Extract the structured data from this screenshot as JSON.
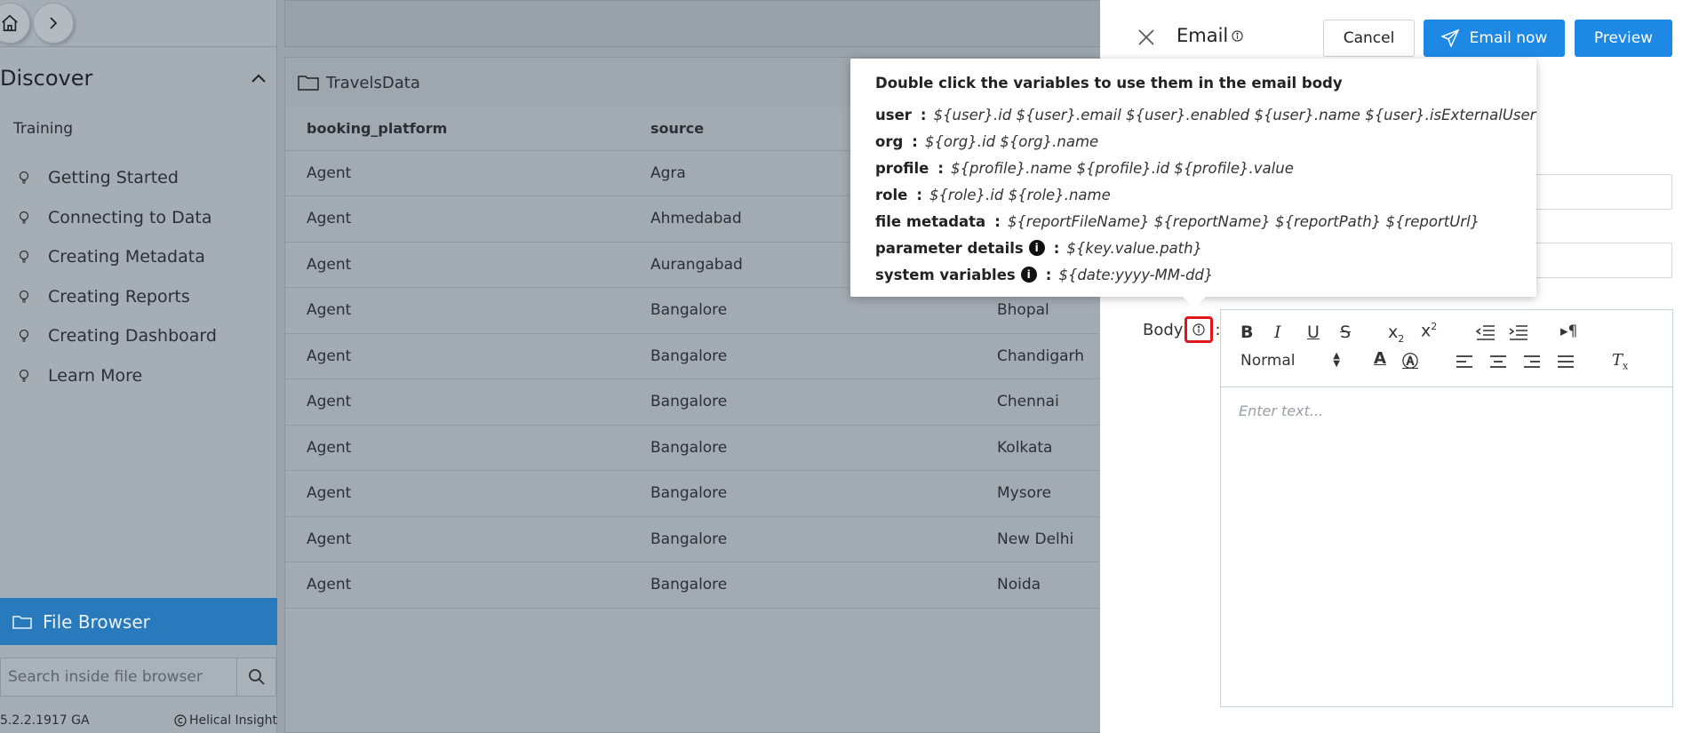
{
  "sidebar": {
    "discover_title": "Discover",
    "section_label": "Training",
    "items": [
      {
        "label": "Getting Started"
      },
      {
        "label": "Connecting to Data"
      },
      {
        "label": "Creating Metadata"
      },
      {
        "label": "Creating Reports"
      },
      {
        "label": "Creating Dashboard"
      },
      {
        "label": "Learn More"
      }
    ],
    "file_browser_label": "File Browser",
    "search_placeholder": "Search inside file browser",
    "version": "5.2.2.1917 GA",
    "brand": "Helical Insight"
  },
  "main": {
    "folder_name": "TravelsData",
    "columns": [
      "booking_platform",
      "source"
    ],
    "rows": [
      [
        "Agent",
        "Agra",
        ""
      ],
      [
        "Agent",
        "Ahmedabad",
        ""
      ],
      [
        "Agent",
        "Aurangabad",
        ""
      ],
      [
        "Agent",
        "Bangalore",
        "Bhopal"
      ],
      [
        "Agent",
        "Bangalore",
        "Chandigarh"
      ],
      [
        "Agent",
        "Bangalore",
        "Chennai"
      ],
      [
        "Agent",
        "Bangalore",
        "Kolkata"
      ],
      [
        "Agent",
        "Bangalore",
        "Mysore"
      ],
      [
        "Agent",
        "Bangalore",
        "New Delhi"
      ],
      [
        "Agent",
        "Bangalore",
        "Noida"
      ]
    ]
  },
  "email": {
    "title": "Email",
    "cancel_label": "Cancel",
    "email_now_label": "Email now",
    "preview_label": "Preview",
    "body_label": "Body",
    "format_select_value": "Normal",
    "editor_placeholder": "Enter text..."
  },
  "tooltip": {
    "title": "Double click the variables to use them in the email body",
    "rows": [
      {
        "key": "user",
        "values": "${user}.id  ${user}.email  ${user}.enabled  ${user}.name  ${user}.isExternalUser"
      },
      {
        "key": "org",
        "values": "${org}.id  ${org}.name"
      },
      {
        "key": "profile",
        "values": "${profile}.name  ${profile}.id  ${profile}.value"
      },
      {
        "key": "role",
        "values": "${role}.id  ${role}.name"
      },
      {
        "key": "file metadata",
        "values": "${reportFileName}  ${reportName}  ${reportPath}  ${reportUrl}"
      },
      {
        "key": "parameter details",
        "values": "${key.value.path}"
      },
      {
        "key": "system variables",
        "values": "${date:yyyy-MM-dd}"
      }
    ]
  },
  "colors": {
    "primary": "#1e88e5",
    "file_browser": "#2979bd",
    "highlight": "#e0161c"
  }
}
